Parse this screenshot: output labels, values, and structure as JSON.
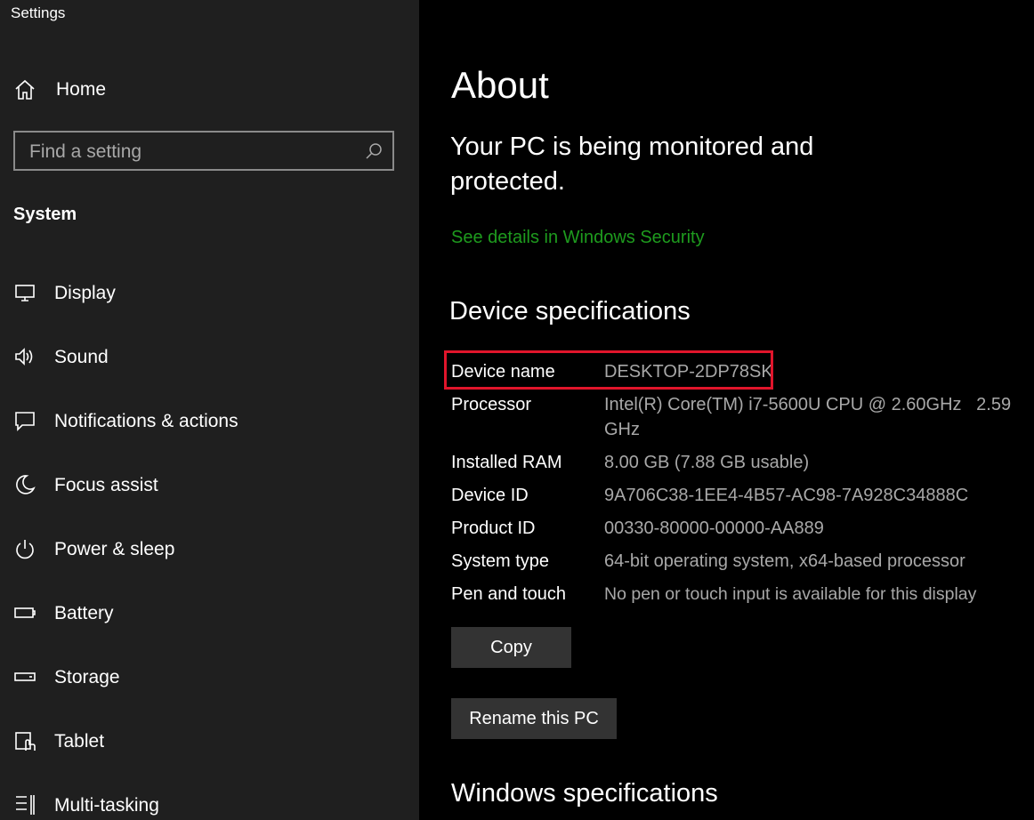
{
  "app": {
    "title": "Settings"
  },
  "sidebar": {
    "home_label": "Home",
    "search_placeholder": "Find a setting",
    "search_value": "",
    "section_label": "System",
    "items": [
      {
        "label": "Display",
        "icon": "monitor-icon"
      },
      {
        "label": "Sound",
        "icon": "speaker-icon"
      },
      {
        "label": "Notifications & actions",
        "icon": "notification-icon"
      },
      {
        "label": "Focus assist",
        "icon": "moon-icon"
      },
      {
        "label": "Power & sleep",
        "icon": "power-icon"
      },
      {
        "label": "Battery",
        "icon": "battery-icon"
      },
      {
        "label": "Storage",
        "icon": "storage-icon"
      },
      {
        "label": "Tablet",
        "icon": "tablet-icon"
      },
      {
        "label": "Multi-tasking",
        "icon": "multitasking-icon"
      }
    ]
  },
  "main": {
    "title": "About",
    "protection_text": "Your PC is being monitored and protected.",
    "security_link": "See details in Windows Security",
    "device_specs_heading": "Device specifications",
    "specs": [
      {
        "key": "Device name",
        "value": "DESKTOP-2DP78SK"
      },
      {
        "key": "Processor",
        "value": "Intel(R) Core(TM) i7-5600U CPU @ 2.60GHz   2.59 GHz"
      },
      {
        "key": "Installed RAM",
        "value": "8.00 GB (7.88 GB usable)"
      },
      {
        "key": "Device ID",
        "value": "9A706C38-1EE4-4B57-AC98-7A928C34888C"
      },
      {
        "key": "Product ID",
        "value": "00330-80000-00000-AA889"
      },
      {
        "key": "System type",
        "value": "64-bit operating system, x64-based processor"
      },
      {
        "key": "Pen and touch",
        "value": "No pen or touch input is available for this display"
      }
    ],
    "copy_label": "Copy",
    "rename_label": "Rename this PC",
    "windows_specs_heading": "Windows specifications"
  },
  "colors": {
    "sidebar_bg": "#1f1f1f",
    "main_bg": "#000000",
    "link_green": "#1e9b1e",
    "highlight_red": "#e0152b",
    "button_bg": "#333333",
    "value_gray": "#a8a8a8"
  }
}
